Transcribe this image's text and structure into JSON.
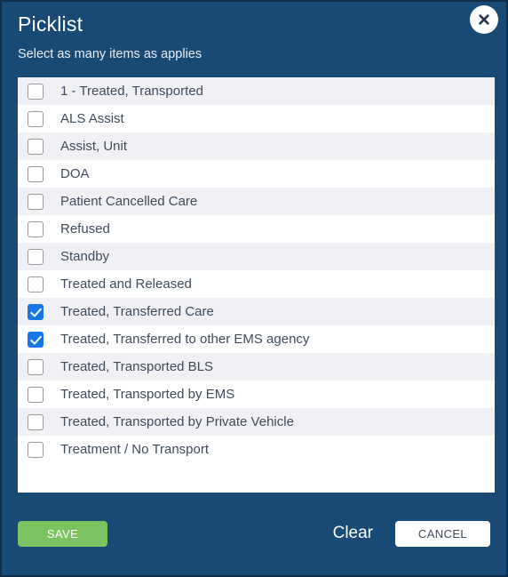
{
  "dialog": {
    "title": "Picklist",
    "subtitle": "Select as many items as applies",
    "close_icon": "close-icon"
  },
  "colors": {
    "dialog_background": "#184a75",
    "dialog_border": "#0f2d48",
    "list_background": "#ffffff",
    "row_alt_background": "#f1f1f5",
    "row_text": "#3f4c5e",
    "checkbox_checked": "#1577e8",
    "checkbox_border": "#9a9a9a",
    "save_button": "#7cc462",
    "cancel_button": "#ffffff",
    "header_text": "#ffffff"
  },
  "list": {
    "items": [
      {
        "label": "1 - Treated, Transported",
        "checked": false
      },
      {
        "label": "ALS Assist",
        "checked": false
      },
      {
        "label": "Assist, Unit",
        "checked": false
      },
      {
        "label": "DOA",
        "checked": false
      },
      {
        "label": "Patient Cancelled Care",
        "checked": false
      },
      {
        "label": "Refused",
        "checked": false
      },
      {
        "label": "Standby",
        "checked": false
      },
      {
        "label": "Treated and Released",
        "checked": false
      },
      {
        "label": "Treated, Transferred Care",
        "checked": true
      },
      {
        "label": "Treated, Transferred to other EMS agency",
        "checked": true
      },
      {
        "label": "Treated, Transported BLS",
        "checked": false
      },
      {
        "label": "Treated, Transported by EMS",
        "checked": false
      },
      {
        "label": "Treated, Transported by Private Vehicle",
        "checked": false
      },
      {
        "label": "Treatment / No Transport",
        "checked": false
      }
    ]
  },
  "footer": {
    "save_label": "SAVE",
    "clear_label": "Clear",
    "cancel_label": "CANCEL"
  }
}
